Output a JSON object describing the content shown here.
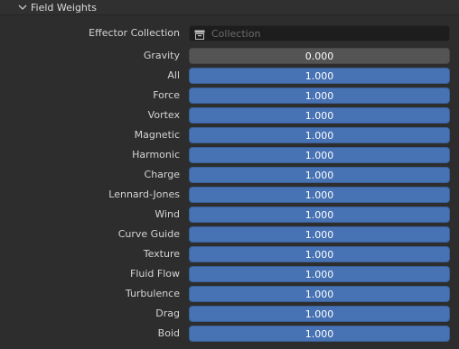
{
  "panel": {
    "title": "Field Weights",
    "collapse_icon": "chevron-down-icon"
  },
  "effector_collection": {
    "label": "Effector Collection",
    "placeholder": "Collection",
    "icon": "collection-icon"
  },
  "weights": [
    {
      "label": "Gravity",
      "value": "0.000"
    },
    {
      "label": "All",
      "value": "1.000"
    },
    {
      "label": "Force",
      "value": "1.000"
    },
    {
      "label": "Vortex",
      "value": "1.000"
    },
    {
      "label": "Magnetic",
      "value": "1.000"
    },
    {
      "label": "Harmonic",
      "value": "1.000"
    },
    {
      "label": "Charge",
      "value": "1.000"
    },
    {
      "label": "Lennard-Jones",
      "value": "1.000"
    },
    {
      "label": "Wind",
      "value": "1.000"
    },
    {
      "label": "Curve Guide",
      "value": "1.000"
    },
    {
      "label": "Texture",
      "value": "1.000"
    },
    {
      "label": "Fluid Flow",
      "value": "1.000"
    },
    {
      "label": "Turbulence",
      "value": "1.000"
    },
    {
      "label": "Drag",
      "value": "1.000"
    },
    {
      "label": "Boid",
      "value": "1.000"
    }
  ],
  "colors": {
    "background": "#2d2d2d",
    "slider_fill": "#4772b3",
    "slider_empty": "#545454",
    "field_dark": "#1d1d1d"
  }
}
